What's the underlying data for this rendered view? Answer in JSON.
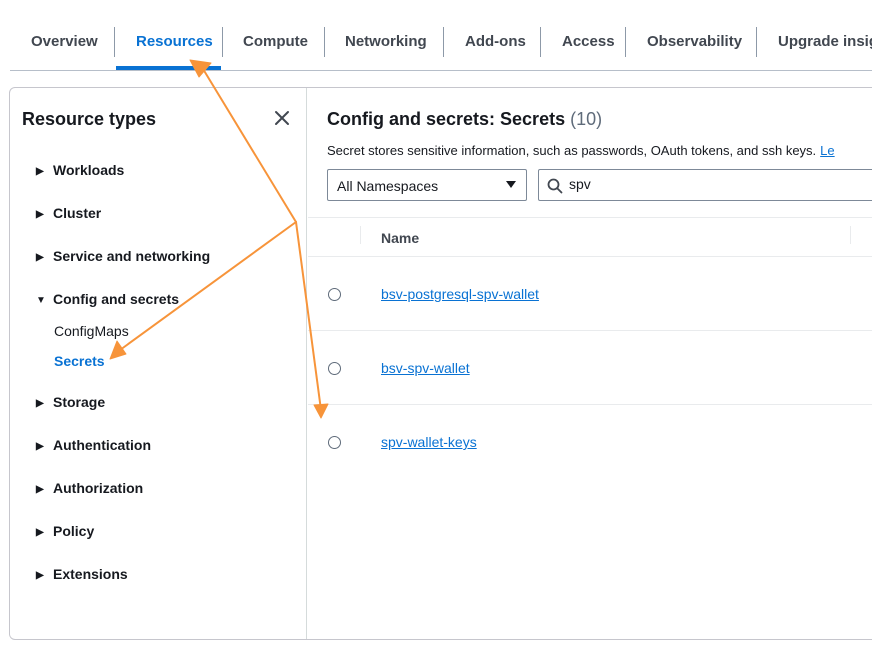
{
  "tabs": [
    {
      "label": "Overview"
    },
    {
      "label": "Resources"
    },
    {
      "label": "Compute"
    },
    {
      "label": "Networking"
    },
    {
      "label": "Add-ons"
    },
    {
      "label": "Access"
    },
    {
      "label": "Observability"
    },
    {
      "label": "Upgrade insigh"
    }
  ],
  "active_tab": "Resources",
  "sidebar": {
    "title": "Resource types",
    "items": [
      {
        "label": "Workloads",
        "expanded": false
      },
      {
        "label": "Cluster",
        "expanded": false
      },
      {
        "label": "Service and networking",
        "expanded": false
      },
      {
        "label": "Config and secrets",
        "expanded": true
      },
      {
        "label": "Storage",
        "expanded": false
      },
      {
        "label": "Authentication",
        "expanded": false
      },
      {
        "label": "Authorization",
        "expanded": false
      },
      {
        "label": "Policy",
        "expanded": false
      },
      {
        "label": "Extensions",
        "expanded": false
      }
    ],
    "subitems": [
      {
        "label": "ConfigMaps",
        "active": false
      },
      {
        "label": "Secrets",
        "active": true
      }
    ]
  },
  "main": {
    "title": "Config and secrets: Secrets",
    "count": "(10)",
    "description": "Secret stores sensitive information, such as passwords, OAuth tokens, and ssh keys.",
    "description_link": "Le",
    "namespace_select": "All Namespaces",
    "search_value": "spv",
    "table": {
      "columns": [
        "Name"
      ],
      "rows": [
        {
          "name": "bsv-postgresql-spv-wallet"
        },
        {
          "name": "bsv-spv-wallet"
        },
        {
          "name": "spv-wallet-keys"
        }
      ]
    }
  },
  "colors": {
    "accent": "#0972d3",
    "annotation": "#f7943a"
  },
  "icons": {
    "close": "close-icon",
    "caret_right": "caret-right-icon",
    "caret_down": "caret-down-icon",
    "search": "search-icon",
    "dropdown": "dropdown-triangle-icon"
  }
}
